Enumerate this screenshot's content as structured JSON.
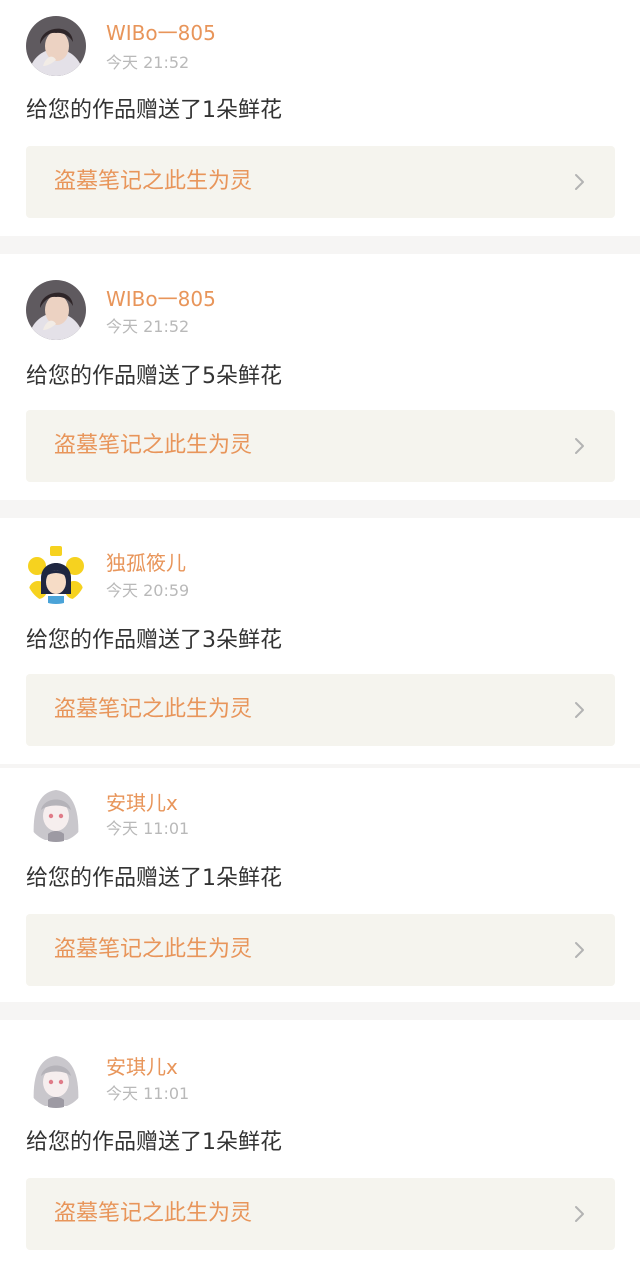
{
  "notifications": [
    {
      "username": "WIBo一805",
      "time": "今天 21:52",
      "message": "给您的作品赠送了1朵鲜花",
      "work_title": "盗墓笔记之此生为灵",
      "avatar": "boy-photo-avatar"
    },
    {
      "username": "WIBo一805",
      "time": "今天 21:52",
      "message": "给您的作品赠送了5朵鲜花",
      "work_title": "盗墓笔记之此生为灵",
      "avatar": "boy-photo-avatar"
    },
    {
      "username": "独孤筱儿",
      "time": "今天 20:59",
      "message": "给您的作品赠送了3朵鲜花",
      "work_title": "盗墓笔记之此生为灵",
      "avatar": "cartoon-girl-avatar"
    },
    {
      "username": "安琪儿x",
      "time": "今天 11:01",
      "message": "给您的作品赠送了1朵鲜花",
      "work_title": "盗墓笔记之此生为灵",
      "avatar": "anime-girl-avatar"
    },
    {
      "username": "安琪儿x",
      "time": "今天 11:01",
      "message": "给您的作品赠送了1朵鲜花",
      "work_title": "盗墓笔记之此生为灵",
      "avatar": "anime-girl-avatar"
    }
  ],
  "icons": {
    "chevron": "chevron-right-icon"
  },
  "colors": {
    "accent": "#e8955a",
    "card_background": "#f5f4ee",
    "timestamp": "#b9b9b9",
    "message_text": "#333333",
    "separator": "#f6f5f4"
  }
}
